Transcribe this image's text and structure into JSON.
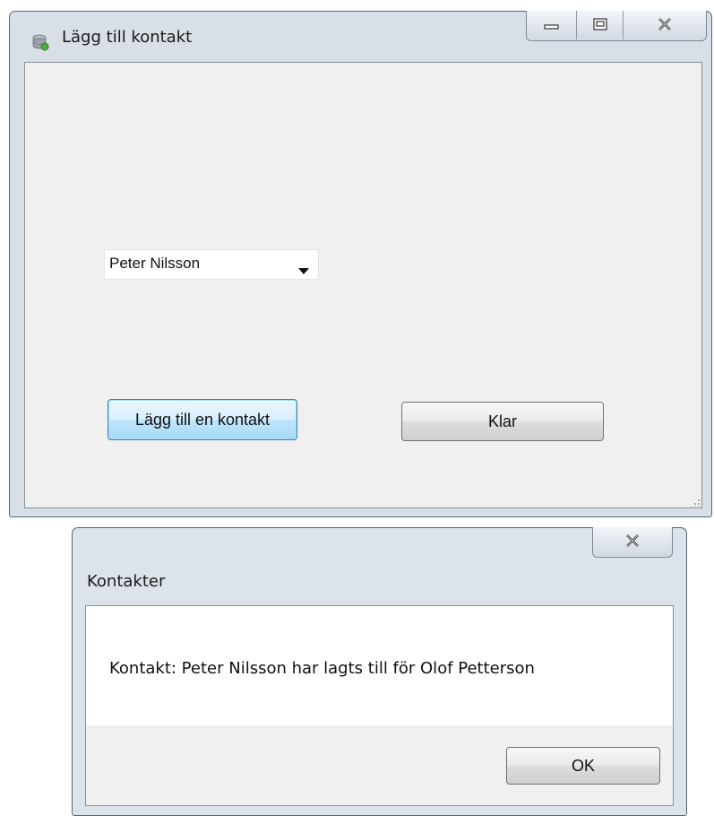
{
  "main_window": {
    "title": "Lägg till kontakt",
    "contact_select": {
      "selected": "Peter Nilsson"
    },
    "add_button_label": "Lägg till en kontakt",
    "done_button_label": "Klar"
  },
  "dialog": {
    "title": "Kontakter",
    "message": "Kontakt: Peter Nilsson har lagts till för Olof Petterson",
    "ok_label": "OK"
  },
  "icons": {
    "app": "database-icon",
    "minimize": "minimize-icon",
    "maximize": "maximize-icon",
    "close": "close-icon",
    "dropdown": "chevron-down-icon",
    "resize": "resize-grip-icon"
  },
  "colors": {
    "dialog_face": "#f0f0f0",
    "frame": "#d9dfe7",
    "focus_button": "#3c7fb1"
  }
}
